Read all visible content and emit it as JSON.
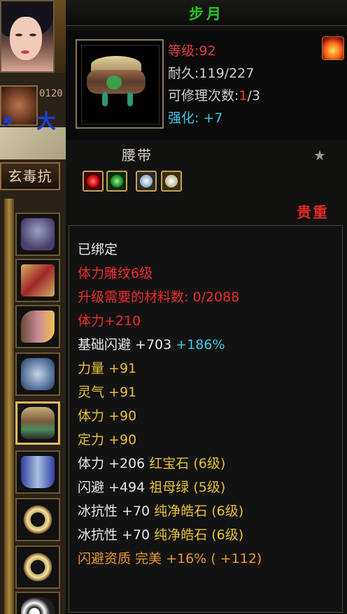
{
  "left": {
    "medal_number": "0120",
    "map_big": "大",
    "map_small": "乡",
    "resist_tab": "玄毒抗"
  },
  "item": {
    "title": "步月",
    "level": "等级:92",
    "durability": "耐久:119/227",
    "repair_prefix": "可修理次数:",
    "repair_used": "1",
    "repair_total": "/3",
    "enhance": "强化: +7",
    "type": "腰带",
    "rarity": "贵重"
  },
  "attributes": [
    {
      "text": "已绑定",
      "color": "white"
    },
    {
      "text": "体力雕纹6级",
      "color": "red"
    },
    {
      "text": "升级需要的材料数: 0/2088",
      "color": "red"
    },
    {
      "text": "体力+210",
      "color": "red"
    },
    {
      "text": "基础闪避  +703",
      "color": "white",
      "extra": "+186%"
    },
    {
      "text": "力量  +91",
      "color": "yellow"
    },
    {
      "text": "灵气  +91",
      "color": "yellow"
    },
    {
      "text": "体力  +90",
      "color": "yellow"
    },
    {
      "text": "定力  +90",
      "color": "yellow"
    },
    {
      "text": "体力  +206",
      "color": "white",
      "extra": "红宝石 (6级)"
    },
    {
      "text": "闪避  +494",
      "color": "white",
      "extra": "祖母绿 (5级)"
    },
    {
      "text": "冰抗性  +70",
      "color": "white",
      "extra": "纯净皓石 (6级)"
    },
    {
      "text": "冰抗性  +70",
      "color": "white",
      "extra": "纯净皓石 (6级)"
    },
    {
      "text": "闪避资质  完美 +16% ( +112)",
      "color": "orange"
    }
  ],
  "icons": [
    "portrait-icon",
    "medal-icon",
    "helmet-icon",
    "scroll-icon",
    "bracer-icon",
    "glove-icon",
    "belt-icon",
    "boots-icon",
    "ring-icon",
    "panda-icon",
    "fire-icon",
    "star-icon",
    "red-gem-icon",
    "green-gem-icon",
    "white-gem-icon"
  ],
  "colors": {
    "title": "#22c822",
    "red": "#ee2a2a",
    "yellow": "#e6c234",
    "cyan": "#3cc8e8",
    "orange": "#e89830"
  }
}
